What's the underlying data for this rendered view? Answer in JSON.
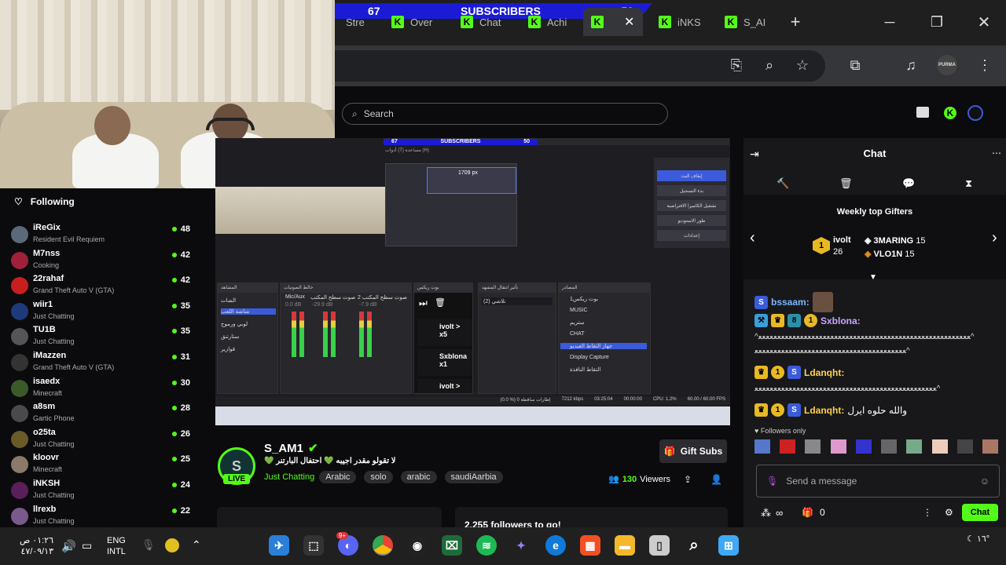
{
  "browser": {
    "sub_banner": {
      "left": "67",
      "label": "SUBSCRIBERS",
      "right": "50"
    },
    "tabs": [
      "Stre",
      "Over",
      "Chat",
      "Achi",
      "",
      "iNKS",
      "S_AI"
    ],
    "new_tab": "+",
    "profile": "PURMA"
  },
  "search": {
    "placeholder": "Search"
  },
  "following": {
    "title": "Following",
    "items": [
      {
        "name": "iReGix",
        "game": "Resident Evil Requiem",
        "count": "48",
        "color": "#5a6a7a"
      },
      {
        "name": "M7nss",
        "game": "Cooking",
        "count": "42",
        "color": "#a0203a"
      },
      {
        "name": "22rahaf",
        "game": "Grand Theft Auto V (GTA)",
        "count": "42",
        "color": "#c81e1e"
      },
      {
        "name": "wiir1",
        "game": "Just Chatting",
        "count": "35",
        "color": "#1e3a7a"
      },
      {
        "name": "TU1B",
        "game": "Just Chatting",
        "count": "35",
        "color": "#555555"
      },
      {
        "name": "iMazzen",
        "game": "Grand Theft Auto V (GTA)",
        "count": "31",
        "color": "#333333"
      },
      {
        "name": "isaedx",
        "game": "Minecraft",
        "count": "30",
        "color": "#3a5a2a"
      },
      {
        "name": "a8sm",
        "game": "Gartic Phone",
        "count": "28",
        "color": "#4a4a4a"
      },
      {
        "name": "o25ta",
        "game": "Just Chatting",
        "count": "26",
        "color": "#6a5a2a"
      },
      {
        "name": "kloovr",
        "game": "Minecraft",
        "count": "25",
        "color": "#8a7a6a"
      },
      {
        "name": "iNKSH",
        "game": "Just Chatting",
        "count": "24",
        "color": "#5a1e5a"
      },
      {
        "name": "llrexb",
        "game": "Just Chatting",
        "count": "22",
        "color": "#7a5a8a"
      }
    ]
  },
  "obs": {
    "banner_left": "67",
    "banner_label": "SUBSCRIBERS",
    "banner_right": "50",
    "preview_size": "1709 px",
    "menu": "أدوات (T)  مساعدة (H)",
    "controls": [
      "إيقاف البث",
      "بدء التسجيل",
      "تشغيل الكاميرا الافتراضية",
      "طور الاستوديو",
      "إعدادات"
    ],
    "docks": [
      "المشاهد",
      "خالط الصوتيات",
      "بوت ريكس",
      "تأثير انتقال المشهد",
      "المصادر"
    ],
    "scenes": [
      "الشات",
      "شاشة اللعب",
      "لوبي ورموج",
      "ستارتنق",
      "قوازير"
    ],
    "mixer_channels": [
      "Mic/Aux",
      "صوت سطح المكتب",
      "صوت سطح المكتب 2"
    ],
    "mixer_db": [
      "0.0 dB",
      "-29.9 dB",
      "-7.9 dB"
    ],
    "alerts": [
      {
        "user": "ivolt >",
        "amount": "x5"
      },
      {
        "user": "Sxblona",
        "amount": "x1"
      },
      {
        "user": "ivolt >",
        "amount": ""
      }
    ],
    "transition": "تلاشي",
    "transition_value": "(2)",
    "sources": [
      "بوت ريكس1",
      "MUSIC",
      "ستريم",
      "CHAT",
      "جهاز التقاط الفيديو",
      "Display Capture",
      "التقاط النافذة"
    ],
    "status": [
      "(0.0 %) 0 إطارات ساقطة",
      "7212 kbps",
      "03:25:04",
      "00:00:00",
      "CPU: 1.2%",
      "60.00 / 60.00 FPS"
    ]
  },
  "stream": {
    "channel": "S_AM1",
    "live": "LIVE",
    "title": "لا تقولو مقدر اجيبه 💚 احتفال البارتنر 💚",
    "category": "Just Chatting",
    "tags": [
      "Arabic",
      "solo",
      "arabic",
      "saudiAarbia"
    ],
    "viewers": "130",
    "viewers_label": "Viewers",
    "gift_subs": "Gift Subs",
    "followers_goal": "2,255 followers to go!"
  },
  "chat": {
    "title": "Chat",
    "top_gifters_title": "Weekly top Gifters",
    "gifters": [
      {
        "rank": "1",
        "name": "ivolt",
        "count": "26"
      },
      {
        "rank": "",
        "name": "3MARING",
        "count": "15"
      },
      {
        "rank": "",
        "name": "VLO1N",
        "count": "15"
      }
    ],
    "messages": [
      {
        "user": "bssaam:",
        "text": "",
        "color": "#7ab6ff"
      },
      {
        "user": "Sxblona:",
        "text": "^ﻌﻌﻌﻌﻌﻌﻌﻌﻌﻌﻌﻌﻌﻌﻌﻌﻌﻌﻌﻌﻌﻌﻌﻌﻌﻌﻌﻌﻌﻌﻌﻌﻌﻌﻌﻌﻌﻌﻌﻌﻌﻌﻌﻌﻌﻌﻌﻌﻌﻌﻌﻌﻌﻌﻌﻌ^",
        "text2": "ﻌﻌﻌﻌﻌﻌﻌﻌﻌﻌﻌﻌﻌﻌﻌﻌﻌﻌﻌﻌﻌﻌﻌﻌﻌﻌﻌﻌﻌﻌﻌﻌﻌﻌﻌﻌﻌﻌﻌﻌ^",
        "color": "#c9a6ff"
      },
      {
        "user": "Ldanqht:",
        "text": "ﻌﻌﻌﻌﻌﻌﻌﻌﻌﻌﻌﻌﻌﻌﻌﻌﻌﻌﻌﻌﻌﻌﻌﻌﻌﻌﻌﻌﻌﻌﻌﻌﻌﻌﻌﻌﻌﻌﻌﻌﻌﻌﻌﻌﻌﻌﻌﻌ^",
        "color": "#ffd24a"
      },
      {
        "user": "Ldanqht:",
        "text": "والله حلوه ايرل",
        "color": "#ffd24a"
      }
    ],
    "followers_only": "Followers only",
    "input_placeholder": "Send a message",
    "points": "∞",
    "gift_count": "0",
    "send_label": "Chat"
  },
  "taskbar": {
    "time": "٠١:٢٦ ص",
    "date": "٤٧/٠٩/١٣",
    "lang_line1": "ENG",
    "lang_line2": "INTL",
    "weather": "١٦°",
    "badge": "9+"
  },
  "colors": {
    "kick_green": "#53fc18",
    "sub_blue": "#1b1bd6",
    "chrome_dark": "#1f1f1f"
  }
}
